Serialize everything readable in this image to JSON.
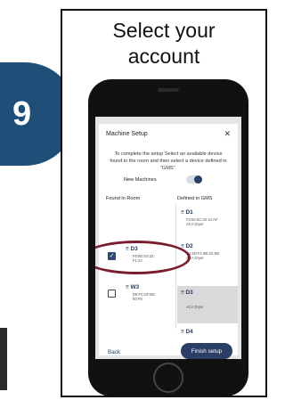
{
  "card": {
    "title": "Select your\naccount"
  },
  "step": {
    "number": "9"
  },
  "dialog": {
    "title": "Machine Setup",
    "close_icon": "close-icon",
    "description": "To complete the setup Select an available device found in the room and then select a device defined in \"GMS\".",
    "new_machines_label": "New Machines",
    "found_in_room_header": "Found in Room",
    "defined_in_gms_header": "Defined in GMS",
    "found_items": [
      {
        "name": "D3",
        "line1": "F6:8E:D4:32:",
        "line2": "F1:22",
        "checked": true
      },
      {
        "name": "W3",
        "line1": "D8:FC:5F:B0:",
        "line2": "50:F8",
        "checked": false
      }
    ],
    "gms_items": [
      {
        "name": "D1",
        "line1": "F3:50:5C:32:10:AF",
        "line2": "ACA Dryer"
      },
      {
        "name": "D2",
        "line1": "C4:5D:F1:8B:2C:6B",
        "line2": "ACA Dryer"
      },
      {
        "name": "D3",
        "line1": "",
        "line2": "ACA Dryer"
      },
      {
        "name": "D4",
        "line1": "",
        "line2": ""
      }
    ],
    "back_label": "Back",
    "finish_label": "Finish setup"
  },
  "colors": {
    "badge": "#1f4e79",
    "primary": "#2a3e66",
    "highlight_ring": "#7b1b2e"
  }
}
